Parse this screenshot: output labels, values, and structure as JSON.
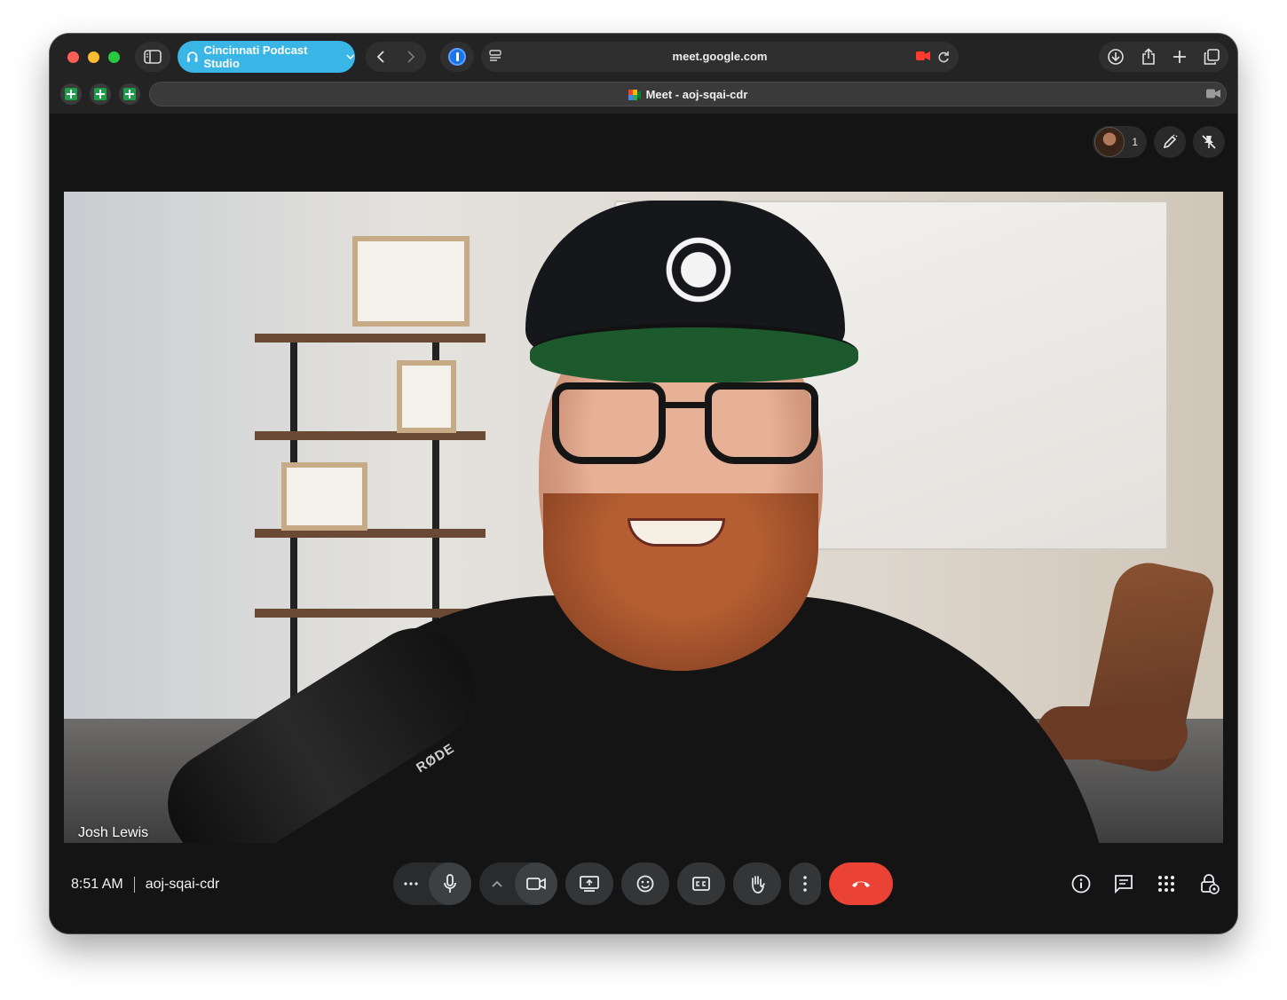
{
  "browser": {
    "tab_group_label": "Cincinnati Podcast Studio",
    "address": "meet.google.com",
    "tab_title": "Meet - aoj-sqai-cdr"
  },
  "meet": {
    "participant_count": "1",
    "participant_name": "Josh Lewis",
    "time": "8:51 AM",
    "meeting_code": "aoj-sqai-cdr",
    "mic_brand": "RØDE"
  },
  "colors": {
    "tab_group": "#3ab6e6",
    "end_call": "#ea4335",
    "control_bg": "#333537",
    "page_bg": "#141414"
  },
  "icons": {
    "browser": [
      "sidebar-icon",
      "headphones-icon",
      "chevron-down-icon",
      "back-icon",
      "forward-icon",
      "password-manager-icon",
      "reader-icon",
      "camera-recording-icon",
      "reload-icon",
      "download-icon",
      "share-icon",
      "new-tab-icon",
      "tab-overview-icon",
      "spreadsheet-icon",
      "video-icon"
    ],
    "meet": [
      "pen-icon",
      "unpin-icon",
      "more-options-icon",
      "microphone-icon",
      "chevron-up-icon",
      "camera-icon",
      "present-screen-icon",
      "emoji-icon",
      "captions-icon",
      "raise-hand-icon",
      "more-vert-icon",
      "end-call-icon",
      "info-icon",
      "chat-icon",
      "apps-icon",
      "host-controls-icon"
    ]
  }
}
